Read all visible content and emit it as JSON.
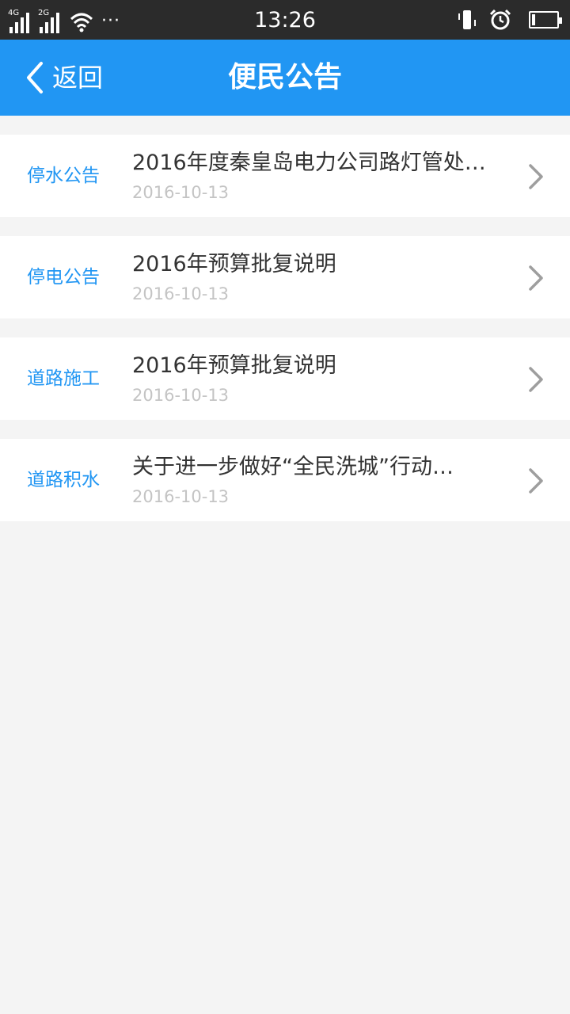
{
  "status_bar": {
    "network_1": "4G",
    "network_2": "2G",
    "more": "···",
    "time": "13:26",
    "icons": [
      "signal-icon",
      "wifi-icon",
      "vibrate-icon",
      "alarm-icon",
      "battery-icon"
    ]
  },
  "header": {
    "back_label": "返回",
    "title": "便民公告",
    "color": "#2196f3"
  },
  "notices": [
    {
      "category": "停水公告",
      "title": "2016年度秦皇岛电力公司路灯管处…",
      "date": "2016-10-13"
    },
    {
      "category": "停电公告",
      "title": "2016年预算批复说明",
      "date": "2016-10-13"
    },
    {
      "category": "道路施工",
      "title": "2016年预算批复说明",
      "date": "2016-10-13"
    },
    {
      "category": "道路积水",
      "title": "关于进一步做好“全民洗城”行动…",
      "date": "2016-10-13"
    }
  ]
}
